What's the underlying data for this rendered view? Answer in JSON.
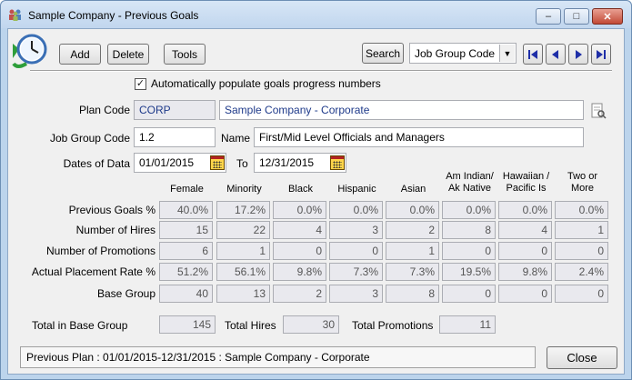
{
  "window": {
    "title": "Sample Company - Previous Goals",
    "min": "–",
    "max": "□",
    "close": "✕"
  },
  "toolbar": {
    "add": "Add",
    "delete": "Delete",
    "tools": "Tools",
    "search": "Search",
    "search_select": "Job Group Code"
  },
  "auto_populate": {
    "checked": true,
    "label": "Automatically populate goals progress numbers"
  },
  "form": {
    "plan_code_label": "Plan Code",
    "plan_code": "CORP",
    "plan_name": "Sample Company - Corporate",
    "job_group_label": "Job Group Code",
    "job_group": "1.2",
    "name_label": "Name",
    "name": "First/Mid Level Officials and Managers",
    "dates_label": "Dates of Data",
    "date_from": "01/01/2015",
    "to_label": "To",
    "date_to": "12/31/2015"
  },
  "grid": {
    "columns": [
      "Female",
      "Minority",
      "Black",
      "Hispanic",
      "Asian",
      "Am Indian/\nAk Native",
      "Hawaiian /\nPacific Is",
      "Two or\nMore"
    ],
    "rows": [
      {
        "label": "Previous Goals %",
        "values": [
          "40.0%",
          "17.2%",
          "0.0%",
          "0.0%",
          "0.0%",
          "0.0%",
          "0.0%",
          "0.0%"
        ]
      },
      {
        "label": "Number of Hires",
        "values": [
          "15",
          "22",
          "4",
          "3",
          "2",
          "8",
          "4",
          "1"
        ]
      },
      {
        "label": "Number of Promotions",
        "values": [
          "6",
          "1",
          "0",
          "0",
          "1",
          "0",
          "0",
          "0"
        ]
      },
      {
        "label": "Actual Placement Rate %",
        "values": [
          "51.2%",
          "56.1%",
          "9.8%",
          "7.3%",
          "7.3%",
          "19.5%",
          "9.8%",
          "2.4%"
        ]
      },
      {
        "label": "Base Group",
        "values": [
          "40",
          "13",
          "2",
          "3",
          "8",
          "0",
          "0",
          "0"
        ]
      }
    ]
  },
  "totals": {
    "base_label": "Total in Base Group",
    "base": "145",
    "hires_label": "Total Hires",
    "hires": "30",
    "promotions_label": "Total Promotions",
    "promotions": "11"
  },
  "status": "Previous Plan : 01/01/2015-12/31/2015 : Sample Company - Corporate",
  "close_button": "Close",
  "colors": {
    "titlebar": "#c9dcf2",
    "field_text": "#1e3a8a",
    "nav_arrow": "#1f2fa8"
  }
}
